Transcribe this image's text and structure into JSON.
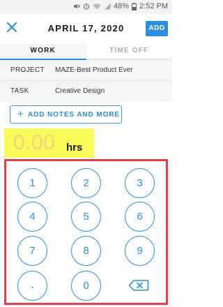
{
  "statusbar": {
    "battery": "48%",
    "time": "2:52 PM"
  },
  "header": {
    "title": "APRIL 17, 2020",
    "add_label": "ADD"
  },
  "tabs": [
    {
      "label": "WORK"
    },
    {
      "label": "TIME OFF"
    }
  ],
  "entry": {
    "project_label": "PROJECT",
    "project_value": "MAZE-Best Product Ever",
    "task_label": "TASK",
    "task_value": "Creative Design"
  },
  "notes_button": {
    "plus": "+",
    "label": "ADD NOTES AND MORE"
  },
  "hours": {
    "value": "0.00",
    "unit": "hrs"
  },
  "keypad": {
    "keys": [
      "1",
      "2",
      "3",
      "4",
      "5",
      "6",
      "7",
      "8",
      "9",
      ".",
      "0"
    ]
  },
  "colors": {
    "accent": "#2a8fe0",
    "highlight": "#fafa5a",
    "frame": "#e04045"
  }
}
